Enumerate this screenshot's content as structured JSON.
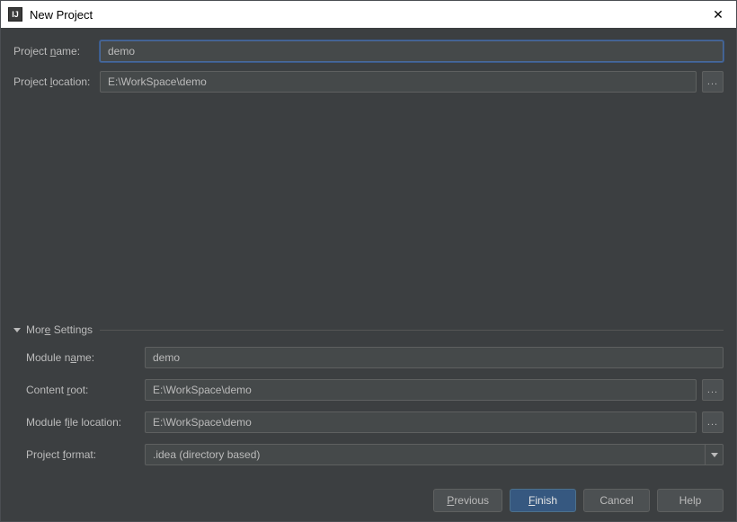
{
  "window": {
    "title": "New Project",
    "close_glyph": "✕"
  },
  "form": {
    "project_name_label": "Project name:",
    "project_name_value": "demo",
    "project_location_label": "Project location:",
    "project_location_value": "E:\\WorkSpace\\demo",
    "browse_glyph": "..."
  },
  "more": {
    "header": "More Settings",
    "module_name_label": "Module name:",
    "module_name_value": "demo",
    "content_root_label": "Content root:",
    "content_root_value": "E:\\WorkSpace\\demo",
    "module_file_loc_label": "Module file location:",
    "module_file_loc_value": "E:\\WorkSpace\\demo",
    "project_format_label": "Project format:",
    "project_format_value": ".idea (directory based)"
  },
  "buttons": {
    "previous": "Previous",
    "finish": "Finish",
    "cancel": "Cancel",
    "help": "Help"
  }
}
